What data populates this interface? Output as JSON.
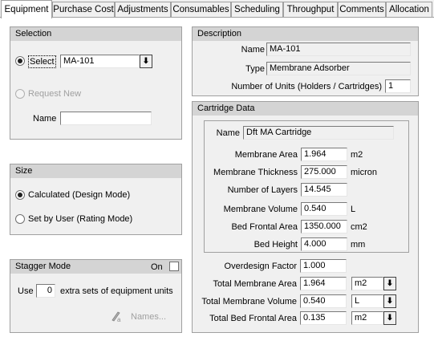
{
  "tabs": [
    {
      "label": "Equipment"
    },
    {
      "label": "Purchase Cost"
    },
    {
      "label": "Adjustments"
    },
    {
      "label": "Consumables"
    },
    {
      "label": "Scheduling"
    },
    {
      "label": "Throughput"
    },
    {
      "label": "Comments"
    },
    {
      "label": "Allocation"
    }
  ],
  "selection": {
    "header": "Selection",
    "select_label": "Select",
    "select_value": "MA-101",
    "request_new_label": "Request New",
    "name_label": "Name",
    "name_value": ""
  },
  "size": {
    "header": "Size",
    "calculated_label": "Calculated (Design Mode)",
    "set_by_user_label": "Set by User (Rating Mode)"
  },
  "stagger": {
    "header": "Stagger Mode",
    "on_label": "On",
    "use_label": "Use",
    "use_value": "0",
    "extra_label": "extra sets of equipment units",
    "names_label": "Names..."
  },
  "description": {
    "header": "Description",
    "name_label": "Name",
    "name_value": "MA-101",
    "type_label": "Type",
    "type_value": "Membrane Adsorber",
    "units_label": "Number of Units (Holders / Cartridges)",
    "units_value": "1"
  },
  "cartridge": {
    "header": "Cartridge Data",
    "name_label": "Name",
    "name_value": "Dft MA Cartridge",
    "membrane_area_label": "Membrane Area",
    "membrane_area_value": "1.964",
    "membrane_area_unit": "m2",
    "membrane_thickness_label": "Membrane Thickness",
    "membrane_thickness_value": "275.000",
    "membrane_thickness_unit": "micron",
    "layers_label": "Number of Layers",
    "layers_value": "14.545",
    "membrane_volume_label": "Membrane Volume",
    "membrane_volume_value": "0.540",
    "membrane_volume_unit": "L",
    "bed_frontal_label": "Bed Frontal Area",
    "bed_frontal_value": "1350.000",
    "bed_frontal_unit": "cm2",
    "bed_height_label": "Bed Height",
    "bed_height_value": "4.000",
    "bed_height_unit": "mm",
    "overdesign_label": "Overdesign Factor",
    "overdesign_value": "1.000",
    "total_area_label": "Total Membrane Area",
    "total_area_value": "1.964",
    "total_area_unit": "m2",
    "total_volume_label": "Total Membrane Volume",
    "total_volume_value": "0.540",
    "total_volume_unit": "L",
    "total_frontal_label": "Total Bed Frontal Area",
    "total_frontal_value": "0.135",
    "total_frontal_unit": "m2"
  }
}
